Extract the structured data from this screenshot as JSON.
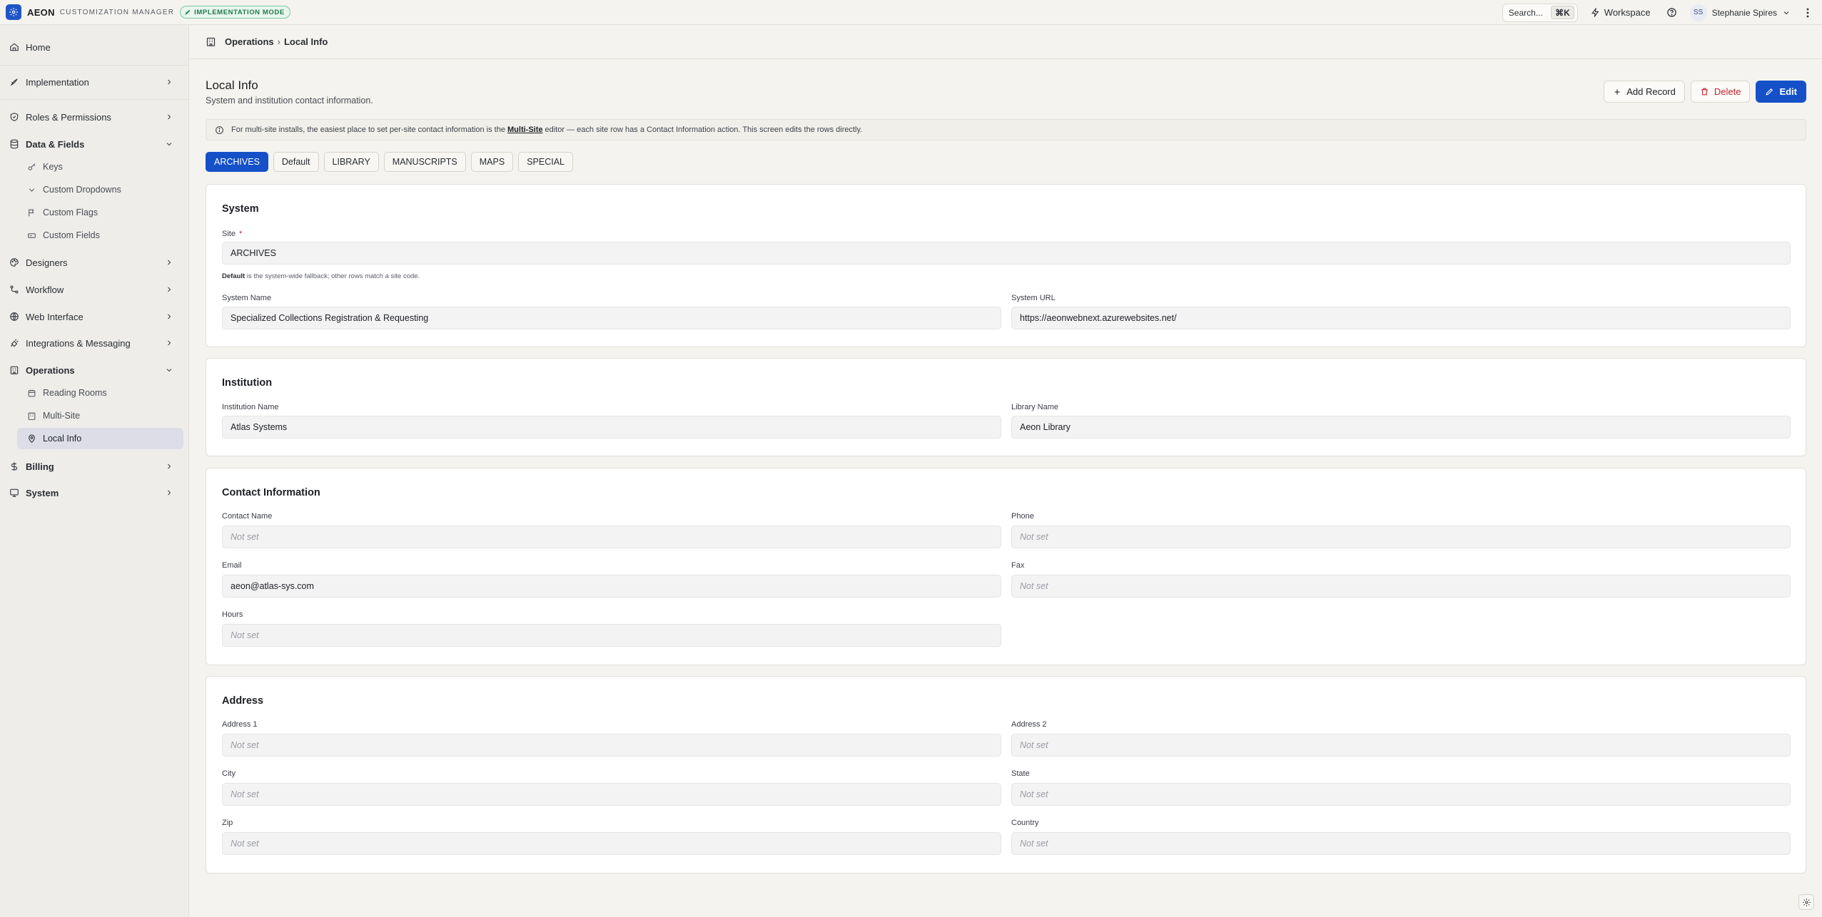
{
  "header": {
    "brand": "AEON",
    "brand_sub": "CUSTOMIZATION MANAGER",
    "mode_badge": "IMPLEMENTATION MODE",
    "search_label": "Search...",
    "search_shortcut": "⌘K",
    "workspace_label": "Workspace",
    "user_initials": "SS",
    "user_name": "Stephanie Spires"
  },
  "sidebar": {
    "home": "Home",
    "implementation": "Implementation",
    "roles": "Roles & Permissions",
    "data_fields": "Data & Fields",
    "keys": "Keys",
    "custom_dropdowns": "Custom Dropdowns",
    "custom_flags": "Custom Flags",
    "custom_fields": "Custom Fields",
    "designers": "Designers",
    "workflow": "Workflow",
    "web_interface": "Web Interface",
    "integrations": "Integrations & Messaging",
    "operations": "Operations",
    "reading_rooms": "Reading Rooms",
    "multi_site": "Multi-Site",
    "local_info": "Local Info",
    "billing": "Billing",
    "system": "System"
  },
  "breadcrumb": {
    "parent": "Operations",
    "separator": "›",
    "current": "Local Info"
  },
  "page": {
    "title": "Local Info",
    "subtitle": "System and institution contact information.",
    "add_record": "Add Record",
    "delete": "Delete",
    "edit": "Edit",
    "info_pre": "For multi-site installs, the easiest place to set per-site contact information is the ",
    "info_link": "Multi-Site",
    "info_post": " editor — each site row has a Contact Information action. This screen edits the rows directly."
  },
  "tabs": [
    "ARCHIVES",
    "Default",
    "LIBRARY",
    "MANUSCRIPTS",
    "MAPS",
    "SPECIAL"
  ],
  "system": {
    "title": "System",
    "site_label": "Site",
    "required_mark": "*",
    "site_value": "ARCHIVES",
    "hint_bold": "Default",
    "hint_rest": " is the system-wide fallback; other rows match a site code.",
    "system_name_label": "System Name",
    "system_name_value": "Specialized Collections Registration & Requesting",
    "system_url_label": "System URL",
    "system_url_value": "https://aeonwebnext.azurewebsites.net/"
  },
  "institution": {
    "title": "Institution",
    "institution_name_label": "Institution Name",
    "institution_name_value": "Atlas Systems",
    "library_name_label": "Library Name",
    "library_name_value": "Aeon Library"
  },
  "contact": {
    "title": "Contact Information",
    "contact_name_label": "Contact Name",
    "contact_name_value": "Not set",
    "phone_label": "Phone",
    "phone_value": "Not set",
    "email_label": "Email",
    "email_value": "aeon@atlas-sys.com",
    "fax_label": "Fax",
    "fax_value": "Not set",
    "hours_label": "Hours",
    "hours_value": "Not set"
  },
  "address": {
    "title": "Address",
    "address1_label": "Address 1",
    "address1_value": "Not set",
    "address2_label": "Address 2",
    "address2_value": "Not set",
    "city_label": "City",
    "city_value": "Not set",
    "state_label": "State",
    "state_value": "Not set",
    "zip_label": "Zip",
    "zip_value": "Not set",
    "country_label": "Country",
    "country_value": "Not set"
  },
  "colors": {
    "accent": "#1550c9",
    "danger": "#c0262d",
    "badge_green": "#1f7a4a"
  }
}
